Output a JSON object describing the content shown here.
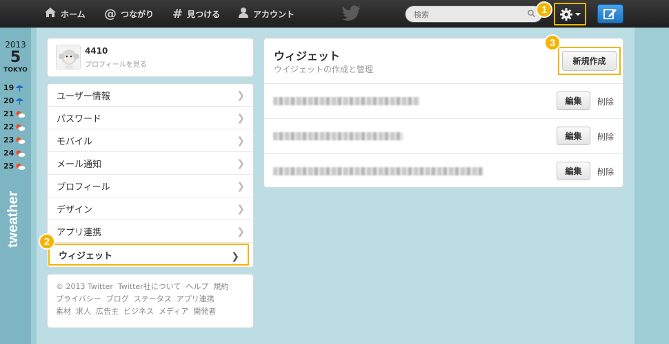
{
  "nav": {
    "home": "ホーム",
    "connect": "つながり",
    "discover": "見つける",
    "account": "アカウント",
    "connect_icon": "@",
    "discover_icon": "#"
  },
  "search": {
    "placeholder": "検索"
  },
  "badges": {
    "one": "1",
    "two": "2",
    "three": "3"
  },
  "weather": {
    "year": "2013",
    "day": "5",
    "city": "TOKYO",
    "rows": [
      {
        "date": "19",
        "icon": "umbrella-icon"
      },
      {
        "date": "20",
        "icon": "umbrella-icon"
      },
      {
        "date": "21",
        "icon": "sun-cloud-icon"
      },
      {
        "date": "22",
        "icon": "sun-cloud-icon"
      },
      {
        "date": "23",
        "icon": "sun-cloud-icon"
      },
      {
        "date": "24",
        "icon": "sun-cloud-icon"
      },
      {
        "date": "25",
        "icon": "sun-cloud-icon"
      }
    ],
    "logo": "tweather"
  },
  "profile": {
    "name": "4410",
    "link": "プロフィールを見る"
  },
  "menu": [
    "ユーザー情報",
    "パスワード",
    "モバイル",
    "メール通知",
    "プロフィール",
    "デザイン",
    "アプリ連携",
    "ウィジェット"
  ],
  "footer": {
    "line1": [
      "© 2013 Twitter",
      "Twitter社について",
      "ヘルプ",
      "規約"
    ],
    "line2": [
      "プライバシー",
      "ブログ",
      "ステータス",
      "アプリ連携"
    ],
    "line3": [
      "素材",
      "求人",
      "広告主",
      "ビジネス",
      "メディア",
      "開発者"
    ]
  },
  "widget": {
    "title": "ウィジェット",
    "subtitle": "ウイジェットの作成と管理",
    "new_label": "新規作成",
    "edit_label": "編集",
    "delete_label": "削除"
  },
  "colors": {
    "highlight": "#f5b400",
    "compose": "#2a86d8"
  }
}
